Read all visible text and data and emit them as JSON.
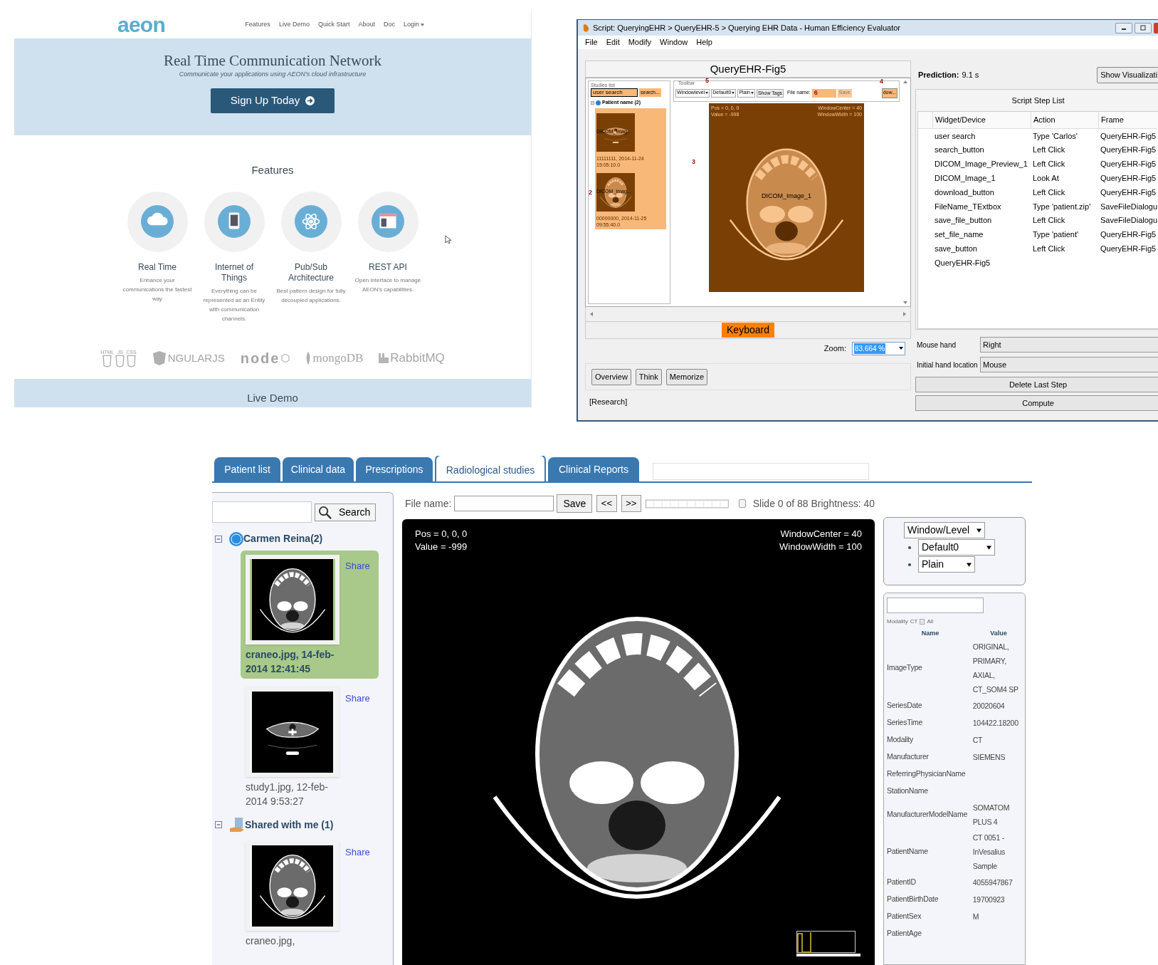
{
  "website": {
    "logo": "aeon",
    "nav": [
      {
        "label": "Features",
        "dropdown": false
      },
      {
        "label": "Live Demo",
        "dropdown": false
      },
      {
        "label": "Quick Start",
        "dropdown": false
      },
      {
        "label": "About",
        "dropdown": false
      },
      {
        "label": "Doc",
        "dropdown": false
      },
      {
        "label": "Login",
        "dropdown": true
      }
    ],
    "hero": {
      "title": "Real Time Communication Network",
      "subtitle": "Communicate your applications using AEON's cloud infrastructure",
      "button": "Sign Up Today"
    },
    "features_title": "Features",
    "features": [
      {
        "kind": "cloud",
        "title": "Real Time",
        "text": "Enhance your communications the fastest way"
      },
      {
        "kind": "tablet",
        "title": "Internet of Things",
        "text": "Everything can be represented as an Entity with communication channels."
      },
      {
        "kind": "atom",
        "title": "Pub/Sub Architecture",
        "text": "Best pattern design for fully decoupled applications."
      },
      {
        "kind": "window",
        "title": "REST API",
        "text": "Open interface to manage AEON's capabilities."
      }
    ],
    "badges": [
      "HTML",
      "JS",
      "CSS"
    ],
    "tech_logos": [
      {
        "kind": "angular",
        "text": "NGULARJS"
      },
      {
        "kind": "node",
        "text": "node"
      },
      {
        "kind": "mongo",
        "text": "mongoDB"
      },
      {
        "kind": "rabbit",
        "text": "RabbitMQ"
      }
    ],
    "footer": "Live Demo"
  },
  "evaluator": {
    "title": "Script: QueryingEHR > QueryEHR-5 > Querying EHR Data - Human Efficiency Evaluator",
    "menu": [
      "File",
      "Edit",
      "Modify",
      "Window",
      "Help"
    ],
    "frame_title": "QueryEHR-Fig5",
    "mock": {
      "studies_legend": "Studies list",
      "search_value": "user search",
      "search_button": "search...",
      "tree_label": "Patient name (2)",
      "thumbs": [
        {
          "kind": "neck",
          "label": "DICOM_Imag...",
          "date": "11111111, 2014-11-24 15:05:10.0"
        },
        {
          "kind": "head",
          "label": "DICOM_Imag...",
          "date": "00000000, 2014-11-25 09:55:40.0"
        }
      ],
      "toolbar_legend": "Toolbar",
      "selects": [
        "Windowlevel",
        "Default0",
        "Plain"
      ],
      "show_tags": "Show Tags",
      "file_label": "File name:",
      "save": "Save",
      "download": "dow...",
      "image_label": "DICOM_Image_1",
      "overlay_left": [
        "Pos = 0, 0, 0",
        "Value = -998"
      ],
      "overlay_right": [
        "WindowCenter = 40",
        "WindowWidth = 100"
      ],
      "markers": [
        "5",
        "4",
        "6",
        "3",
        "2"
      ]
    },
    "keyboard": "Keyboard",
    "zoom_label": "Zoom:",
    "zoom_value": "83.664 %",
    "zoom_selected": true,
    "buttons": [
      "Overview",
      "Think",
      "Memorize"
    ],
    "status": "[Research]",
    "prediction_label": "Prediction:",
    "prediction_value": "9.1 s",
    "show_button": "Show Visualizati",
    "step_list_title": "Script Step List",
    "columns": [
      "Widget/Device",
      "Action",
      "Frame"
    ],
    "steps": [
      {
        "widget": "user search",
        "action": "Type 'Carlos'",
        "frame": "QueryEHR-Fig5"
      },
      {
        "widget": "search_button",
        "action": "Left Click",
        "frame": "QueryEHR-Fig5"
      },
      {
        "widget": "DICOM_Image_Preview_1",
        "action": "Left Click",
        "frame": "QueryEHR-Fig5"
      },
      {
        "widget": "DICOM_Image_1",
        "action": "Look At",
        "frame": "QueryEHR-Fig5"
      },
      {
        "widget": "download_button",
        "action": "Left Click",
        "frame": "QueryEHR-Fig5"
      },
      {
        "widget": "FileName_TExtbox",
        "action": "Type 'patient.zip'",
        "frame": "SaveFileDialogu"
      },
      {
        "widget": "save_file_button",
        "action": "Left Click",
        "frame": "SaveFileDialogu"
      },
      {
        "widget": "set_file_name",
        "action": "Type 'patient'",
        "frame": "QueryEHR-Fig5"
      },
      {
        "widget": "save_button",
        "action": "Left Click",
        "frame": "QueryEHR-Fig5"
      },
      {
        "widget": "QueryEHR-Fig5"
      }
    ],
    "mouse_hand": {
      "label": "Mouse hand",
      "value": "Right"
    },
    "hand_location": {
      "label": "Initial hand location",
      "value": "Mouse"
    },
    "actions": [
      "Delete Last Step",
      "Compute"
    ]
  },
  "ehr": {
    "tabs": [
      {
        "label": "Patient list",
        "selected": false
      },
      {
        "label": "Clinical data",
        "selected": false
      },
      {
        "label": "Prescriptions",
        "selected": false
      },
      {
        "label": "Radiological studies",
        "selected": true
      },
      {
        "label": "Clinical Reports",
        "selected": false
      }
    ],
    "search_button": "Search",
    "tree": [
      {
        "kind": "patient",
        "label": "Carmen Reina(2)",
        "expanded": true,
        "children": [
          {
            "kind": "head",
            "caption": "craneo.jpg, 14-feb-2014 12:41:45",
            "share": "Share",
            "selected": true
          },
          {
            "kind": "neck",
            "caption": "study1.jpg, 12-feb-2014 9:53:27",
            "share": "Share",
            "selected": false
          }
        ]
      },
      {
        "kind": "shared",
        "label": "Shared with me (1)",
        "expanded": true,
        "children": [
          {
            "kind": "head",
            "caption": "craneo.jpg,",
            "share": "Share",
            "selected": false
          }
        ]
      }
    ],
    "file_label": "File name:",
    "save": "Save",
    "prev": "<<",
    "next": ">>",
    "slide_checked": false,
    "slide_info": "Slide 0 of 88 Brightness: 40",
    "overlay_left": [
      "Pos = 0, 0, 0",
      "Value = -999"
    ],
    "overlay_right": [
      "WindowCenter = 40",
      "WindowWidth = 100"
    ],
    "mode_select": "Window/Level",
    "sub_selects": [
      "Default0",
      "Plain"
    ],
    "tags": {
      "filter_label": "Modality",
      "filter_value": "CT",
      "all_checked": false,
      "all_label": "All",
      "columns": [
        "Name",
        "Value"
      ],
      "rows": [
        {
          "name": "ImageType",
          "value": "ORIGINAL, PRIMARY, AXIAL, CT_SOM4 SP"
        },
        {
          "name": "SeriesDate",
          "value": "20020604"
        },
        {
          "name": "SeriesTime",
          "value": "104422.18200"
        },
        {
          "name": "Modality",
          "value": "CT"
        },
        {
          "name": "Manufacturer",
          "value": "SIEMENS"
        },
        {
          "name": "ReferringPhysicianName"
        },
        {
          "name": "StationName"
        },
        {
          "name": "ManufacturerModelName",
          "value": "SOMATOM PLUS 4"
        },
        {
          "name": "PatientName",
          "value": "CT 0051 - InVesalius Sample"
        },
        {
          "name": "PatientID",
          "value": "4055947867"
        },
        {
          "name": "PatientBirthDate",
          "value": "19700923"
        },
        {
          "name": "PatientSex",
          "value": "M"
        },
        {
          "name": "PatientAge"
        }
      ]
    }
  }
}
